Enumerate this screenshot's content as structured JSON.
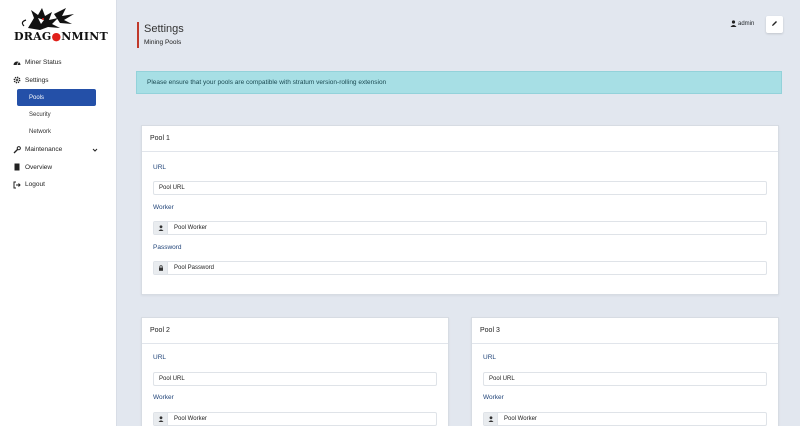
{
  "brand": {
    "logo_text_a": "DRA",
    "logo_text_o": "G",
    "logo_text_b": "NMINT"
  },
  "sidebar": {
    "items": [
      {
        "label": "Miner Status",
        "icon": "dashboard-icon"
      },
      {
        "label": "Settings",
        "icon": "gear-icon"
      },
      {
        "label": "Pools",
        "sub": true,
        "active": true
      },
      {
        "label": "Security",
        "sub": true
      },
      {
        "label": "Network",
        "sub": true
      },
      {
        "label": "Maintenance",
        "icon": "wrench-icon",
        "caret": true
      },
      {
        "label": "Overview",
        "icon": "file-icon"
      },
      {
        "label": "Logout",
        "icon": "logout-icon"
      }
    ]
  },
  "header": {
    "title": "Settings",
    "subtitle": "Mining Pools",
    "user": "admin"
  },
  "alert": {
    "text": "Please ensure that your pools are compatible with stratum version-rolling extension"
  },
  "pools": [
    {
      "title": "Pool 1",
      "url_label": "URL",
      "url_placeholder": "Pool URL",
      "worker_label": "Worker",
      "worker_placeholder": "Pool Worker",
      "password_label": "Password",
      "password_placeholder": "Pool Password"
    },
    {
      "title": "Pool 2",
      "url_label": "URL",
      "url_placeholder": "Pool URL",
      "worker_label": "Worker",
      "worker_placeholder": "Pool Worker"
    },
    {
      "title": "Pool 3",
      "url_label": "URL",
      "url_placeholder": "Pool URL",
      "worker_label": "Worker",
      "worker_placeholder": "Pool Worker"
    }
  ],
  "colors": {
    "accent": "#2450a8",
    "title_bar": "#c0392b",
    "alert_bg": "#a7dfe5",
    "background": "#e2e7ef"
  }
}
